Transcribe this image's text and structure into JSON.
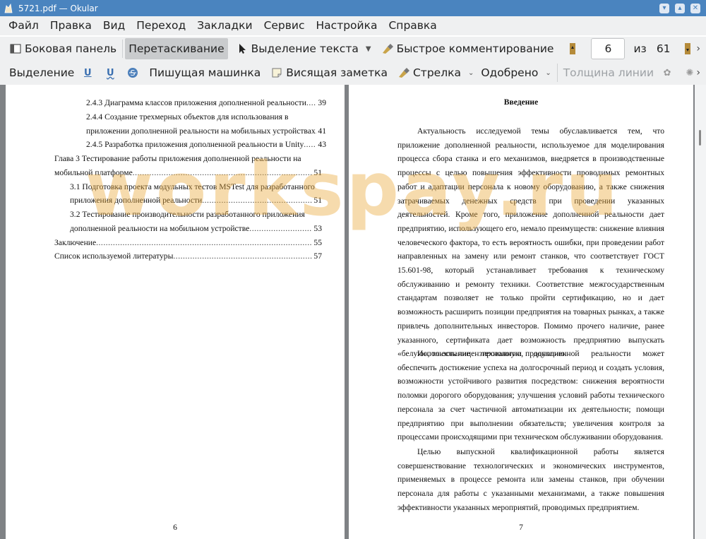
{
  "window": {
    "title": "5721.pdf  — Okular"
  },
  "menu": [
    "Файл",
    "Правка",
    "Вид",
    "Переход",
    "Закладки",
    "Сервис",
    "Настройка",
    "Справка"
  ],
  "toolbar1": {
    "sidebar": "Боковая панель",
    "browse": "Перетаскивание",
    "text_select": "Выделение текста",
    "quick_annot": "Быстрое комментирование",
    "page_current": "6",
    "page_of": "из",
    "page_total": "61"
  },
  "toolbar2": {
    "selection": "Выделение",
    "typewriter": "Пишущая машинка",
    "sticky_note": "Висящая заметка",
    "arrow": "Стрелка",
    "stamp": "Одобрено",
    "line_width": "Толщина линии"
  },
  "left_page": {
    "toc": [
      {
        "text": "2.4.3 Диаграмма классов приложения дополненной реальности",
        "num": "39"
      },
      {
        "text": "2.4.4 Создание трехмерных объектов для использования в",
        "num": ""
      },
      {
        "text": "приложении дополненной реальности на мобильных устройствах",
        "num": "41"
      },
      {
        "text": "2.4.5 Разработка приложения дополненной реальности в Unity",
        "num": "43"
      },
      {
        "text": "Глава 3 Тестирование работы приложения дополненной реальности на",
        "num": ""
      },
      {
        "text": "мобильной платформе",
        "num": "51"
      },
      {
        "text": "3.1 Подготовка проекта модульных тестов MSTest для разработанного",
        "num": ""
      },
      {
        "text": "приложения дополненной реальности",
        "num": "51"
      },
      {
        "text": "3.2 Тестирование производительности разработанного приложения",
        "num": ""
      },
      {
        "text": "дополненной реальности на мобильном устройстве",
        "num": "53"
      },
      {
        "text": "Заключение",
        "num": "55"
      },
      {
        "text": "Список используемой литературы",
        "num": "57"
      }
    ],
    "page_number": "6"
  },
  "right_page": {
    "heading": "Введение",
    "paragraphs": [
      "Актуальность исследуемой темы обуславливается тем, что приложение дополненной реальности, используемое для моделирования процесса сбора станка и его механизмов, внедряется в производственные процессы с целью повышения эффективности проводимых ремонтных работ и адаптации персонала к новому оборудованию, а также снижения затрачиваемых денежных средств при проведении указанных деятельностей. Кроме того, приложение дополненной реальности дает предприятию, использующего его, немало преимуществ: снижение влияния человеческого фактора, то есть вероятность ошибки, при проведении работ направленных на замену или ремонт станков, что соответствует ГОСТ 15.601-98, который устанавливает требования к техническому обслуживанию и ремонту техники. Соответствие межгосударственным стандартам позволяет не только пройти сертификацию, но и дает возможность расширить позиции предприятия на товарных рынках, а также привлечь дополнительных инвесторов. Помимо прочего наличие, ранее указанного, сертификата дает возможность предприятию выпускать «белую», то есть лицензированную, продукцию.",
      "Использование технологии дополненной реальности может обеспечить достижение успеха на долгосрочный период и создать условия, возможности устойчивого развития посредством: снижения вероятности поломки дорогого оборудования; улучшения условий работы технического персонала за счет частичной автоматизации их деятельности; помощи предприятию при выполнении обязательств; увеличения контроля за процессами происходящими при техническом обслуживании оборудования.",
      "Целью выпускной квалификационной работы является совершенствование технологических и экономических инструментов, применяемых в процессе ремонта или замены станков, при обучении персонала для работы с указанными механизмами, а также повышения эффективности указанных мероприятий, проводимых предприятием."
    ],
    "page_number": "7"
  },
  "watermark": "workspay.ru"
}
